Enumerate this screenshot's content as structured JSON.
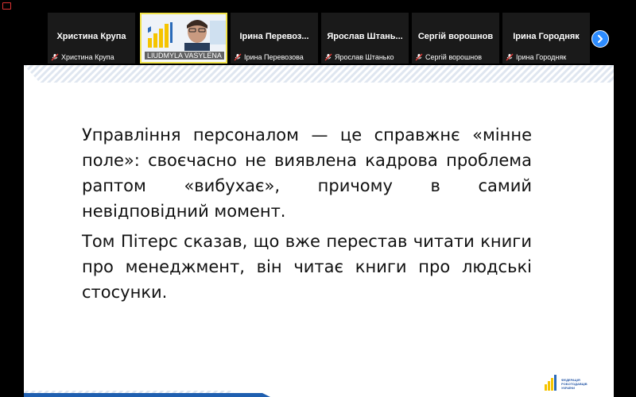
{
  "app": {
    "accent": "#2d8cff",
    "speaker_highlight": "#f0e24a"
  },
  "participants": [
    {
      "name": "Христина Крупа",
      "label": "Христина Крупа",
      "muted": true
    },
    {
      "name": "Ludmyla Vasylena",
      "label": "LIUDMYLA VASYLENA",
      "active": true,
      "video": true,
      "muted": false
    },
    {
      "name": "Ірина Перевоз...",
      "label": "Ірина Перевозова",
      "muted": true
    },
    {
      "name": "Ярослав Штань...",
      "label": "Ярослав Штанько",
      "muted": true
    },
    {
      "name": "Сергій ворошнов",
      "label": "Сергій ворошнов",
      "muted": true
    },
    {
      "name": "Ірина Городняк",
      "label": "Ірина Городняк",
      "muted": true
    }
  ],
  "shared_slide": {
    "paragraph1": "Управління персоналом — це справжнє «мінне поле»: своєчасно не виявлена кадрова проблема раптом «вибухає», причому в самий невідповідний момент.",
    "paragraph2": "Том Пітерс сказав, що вже перестав читати книги про менеджмент, він читає книги про людські стосунки.",
    "logo_text": "ФЕДЕРАЦІЯ РОБОТОДАВЦІВ УКРАЇНИ"
  }
}
